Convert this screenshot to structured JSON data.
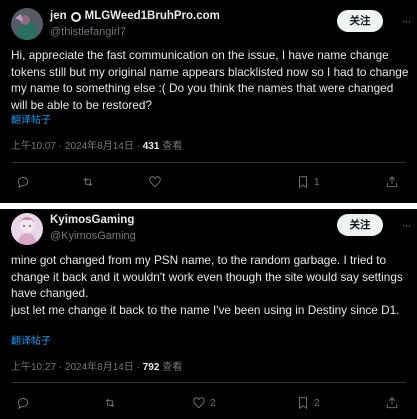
{
  "colors": {
    "accent": "#1d9bf0",
    "verified_badge": "#e7e9ea",
    "background": "#000000"
  },
  "tweets": [
    {
      "display_name": "jen",
      "badge_icon": "circle-badge-icon",
      "affiliation": "MLGWeed1BruhPro.com",
      "handle": "@thistlefangirl7",
      "follow_label": "关注",
      "text": "Hi, appreciate the fast communication on the issue, I have name change tokens still but my original name appears blacklisted now so I had to change my name to something else :( Do you think the names that were changed will be able to be restored?",
      "translate_label": "翻译帖子",
      "time": "上午10:07 · 2024年8月14日 · ",
      "views_count": "431",
      "views_label": " 查看",
      "actions": {
        "reply": "",
        "repost": "",
        "like": "",
        "bookmark": "1"
      }
    },
    {
      "display_name": "KyimosGaming",
      "handle": "@KyimosGaming",
      "follow_label": "关注",
      "text": "mine got changed from my PSN name, to the random garbage. I tried to change it back and it wouldn't work even though the site would say settings have changed.\njust let me change it back to the name I've been using in Destiny since D1.",
      "translate_label": "翻译帖子",
      "time": "上午10:27 · 2024年8月14日 · ",
      "views_count": "792",
      "views_label": " 查看",
      "actions": {
        "reply": "",
        "repost": "",
        "like": "2",
        "bookmark": "2"
      }
    }
  ]
}
